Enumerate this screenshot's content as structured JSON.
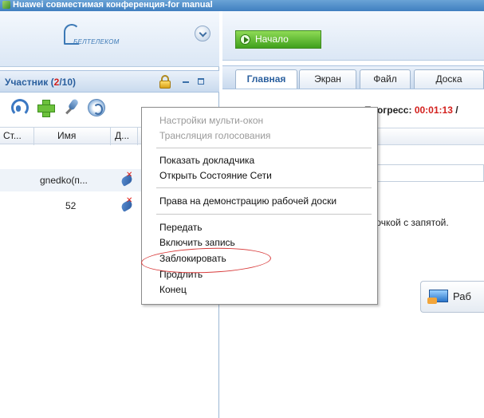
{
  "window": {
    "title": "Huawei совместимая конференция-for manual"
  },
  "logo": {
    "text": "БЕЛТЕЛЕКОМ"
  },
  "participants": {
    "title_prefix": "Участник (",
    "current": "2",
    "total": "/10)"
  },
  "grid": {
    "columns": [
      "Ст...",
      "Имя",
      "Д..."
    ],
    "rows": [
      {
        "name": "gnedko(п..."
      },
      {
        "name": "52"
      }
    ]
  },
  "right": {
    "start_label": "Начало",
    "tabs": [
      "Главная",
      "Экран",
      "Файл",
      "Доска"
    ],
    "progress_label": "Прогресс:",
    "progress_time": "00:01:13",
    "progress_suffix": " /",
    "hint_text": "ючкой с запятой.",
    "board_button_label": "Раб"
  },
  "context_menu": {
    "items": [
      {
        "label": "Настройки мульти-окон",
        "enabled": false
      },
      {
        "label": "Трансляция голосования",
        "enabled": false
      },
      {
        "label": "Показать докладчика",
        "enabled": true
      },
      {
        "label": "Открыть Состояние Сети",
        "enabled": true
      },
      {
        "label": "Права на демонстрацию рабочей доски",
        "enabled": true
      },
      {
        "label": "Передать",
        "enabled": true
      },
      {
        "label": "Включить запись",
        "enabled": true
      },
      {
        "label": "Заблокировать",
        "enabled": true,
        "highlighted": true
      },
      {
        "label": "Продлить",
        "enabled": true
      },
      {
        "label": "Конец",
        "enabled": true
      }
    ]
  },
  "colors": {
    "accent": "#2a5f9e",
    "highlight_ring": "#d83a3a",
    "progress_time": "#d3201d"
  }
}
